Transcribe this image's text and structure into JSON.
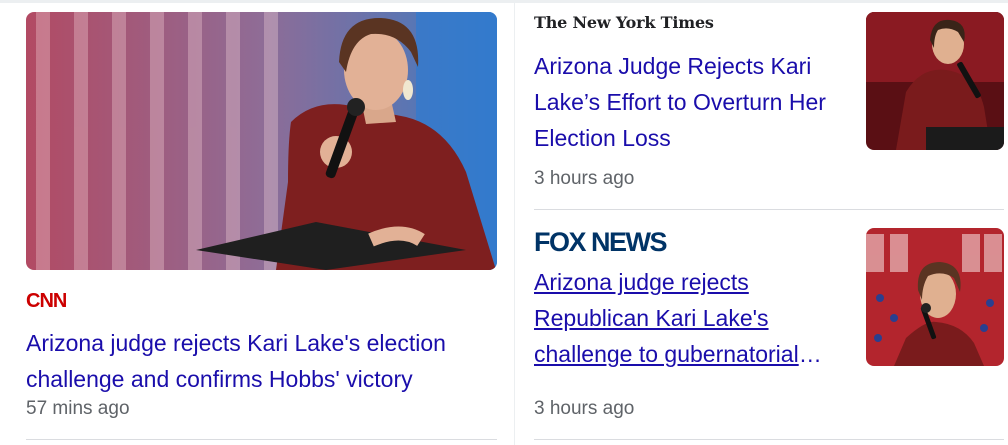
{
  "left_card": {
    "image_icon": "kari-lake-speaking-photo",
    "source_logo": "CNN",
    "title": "Arizona judge rejects Kari Lake's election challenge and confirms Hobbs' victory",
    "time": "57 mins ago"
  },
  "right_cards": [
    {
      "source_logo": "The New York Times",
      "title": "Arizona Judge Rejects Kari Lake’s Effort to Overturn Her Election Loss",
      "time": "3 hours ago",
      "thumbnail_icon": "kari-lake-podium-photo"
    },
    {
      "source_logo": "FOX NEWS",
      "title": "Arizona judge rejects Republican Kari Lake's challenge to gubernatorial loss",
      "time": "3 hours ago",
      "thumbnail_icon": "kari-lake-rally-photo"
    }
  ],
  "colors": {
    "link": "#1a0dab",
    "meta": "#5f6368",
    "cnn_red": "#cc0000",
    "fox_navy": "#003366"
  }
}
